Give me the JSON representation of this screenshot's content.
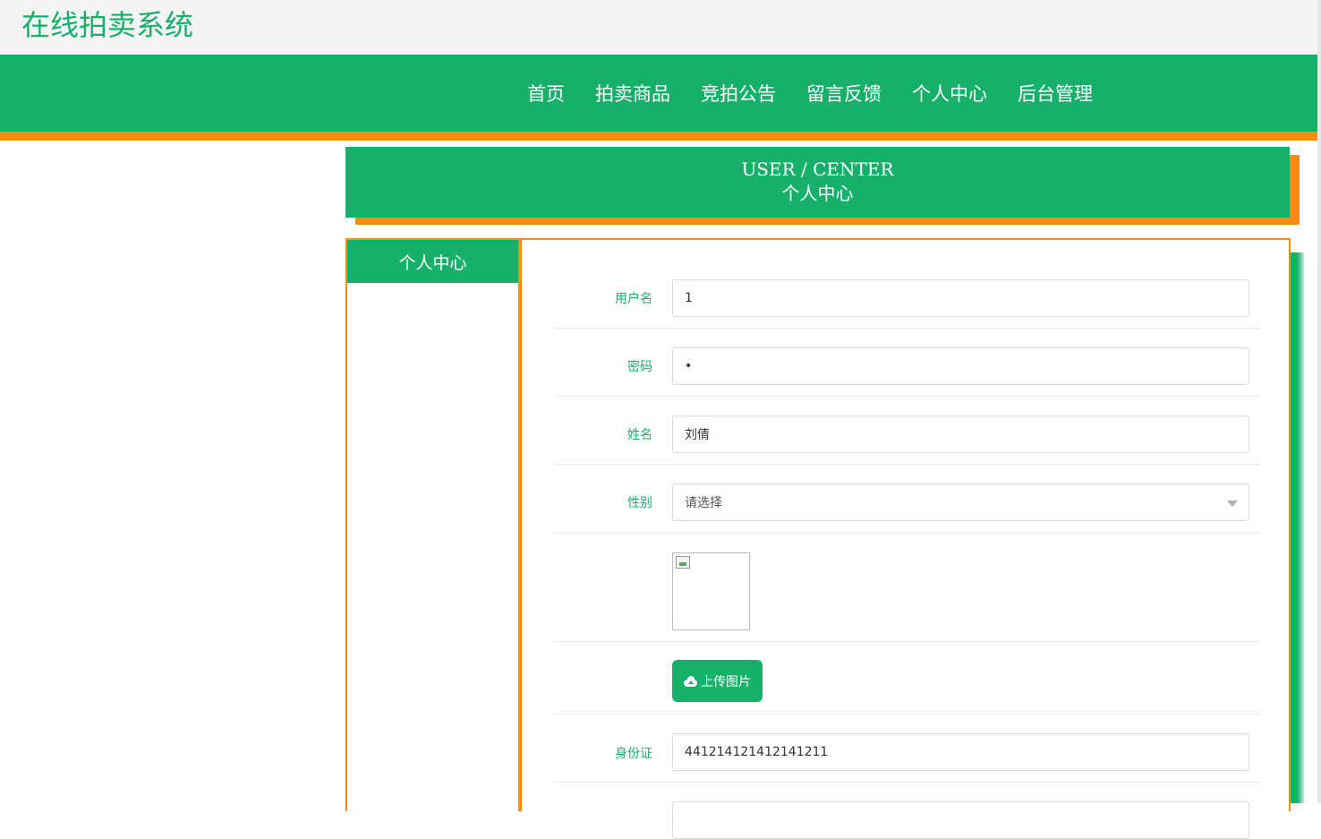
{
  "header": {
    "site_title": "在线拍卖系统"
  },
  "nav": {
    "items": [
      {
        "label": "首页"
      },
      {
        "label": "拍卖商品"
      },
      {
        "label": "竞拍公告"
      },
      {
        "label": "留言反馈"
      },
      {
        "label": "个人中心"
      },
      {
        "label": "后台管理"
      }
    ]
  },
  "banner": {
    "title_en": "USER / CENTER",
    "title_cn": "个人中心"
  },
  "sidebar": {
    "header": "个人中心"
  },
  "form": {
    "username": {
      "label": "用户名",
      "value": "1"
    },
    "password": {
      "label": "密码",
      "value": "•"
    },
    "name": {
      "label": "姓名",
      "value": "刘倩"
    },
    "gender": {
      "label": "性别",
      "value": "请选择"
    },
    "upload": {
      "button_label": "上传图片"
    },
    "id_card": {
      "label": "身份证",
      "value": "441214121412141211"
    }
  },
  "colors": {
    "brand_green": "#17b06b",
    "accent_orange": "#fa8c16"
  }
}
